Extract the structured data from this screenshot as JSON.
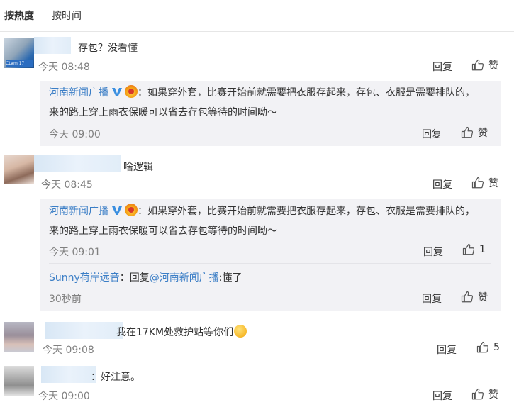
{
  "sort": {
    "hot": "按热度",
    "time": "按时间"
  },
  "ui": {
    "reply": "回复",
    "like": "赞"
  },
  "comments": [
    {
      "text": "存包？没看懂",
      "time": "今天 08:48",
      "like_count": "",
      "replies": [
        {
          "author": "河南新闻广播",
          "text": "：如果穿外套，比赛开始前就需要把衣服存起来，存包、衣服是需要排队的，来的路上穿上雨衣保暖可以省去存包等待的时间呦～",
          "time": "今天 09:00",
          "like_count": ""
        }
      ]
    },
    {
      "text": "啥逻辑",
      "time": "今天 08:45",
      "like_count": "",
      "replies": [
        {
          "author": "河南新闻广播",
          "text": "：如果穿外套，比赛开始前就需要把衣服存起来，存包、衣服是需要排队的，来的路上穿上雨衣保暖可以省去存包等待的时间呦～",
          "time": "今天 09:01",
          "like_count": "1"
        },
        {
          "author": "Sunny荷岸远音",
          "prefix": "：回复",
          "mention": "@河南新闻广播",
          "text": ":懂了",
          "time": "30秒前",
          "like_count": ""
        }
      ]
    },
    {
      "text": "我在17KM处救护站等你们",
      "time": "今天 09:08",
      "like_count": "5",
      "replies": []
    },
    {
      "text": "：好注意。",
      "time": "今天 09:00",
      "like_count": "",
      "replies": []
    }
  ],
  "avatar_badge": "CLVm  17",
  "colors": {
    "link": "#3b7ec6",
    "meta": "#808080",
    "reply_bg": "#f2f2f5",
    "divider": "#e6e6e6"
  }
}
